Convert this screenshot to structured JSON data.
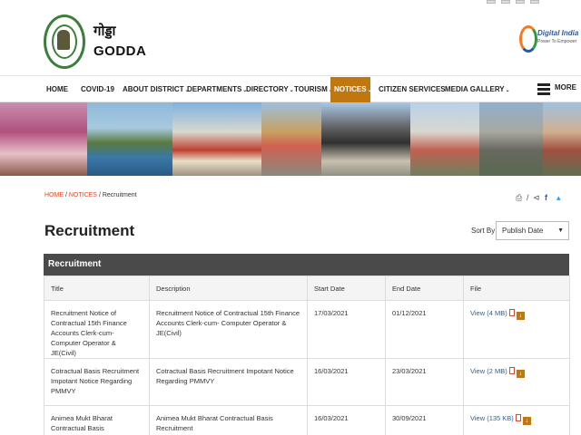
{
  "header": {
    "site_name_hindi": "गोड्डा",
    "site_name": "GODDA",
    "digital_india_title": "Digital India",
    "digital_india_tagline": "Power To Empower"
  },
  "nav": {
    "items": [
      {
        "label": "HOME",
        "has_dropdown": false
      },
      {
        "label": "COVID-19",
        "has_dropdown": false
      },
      {
        "label": "ABOUT DISTRICT",
        "has_dropdown": true
      },
      {
        "label": "DEPARTMENTS",
        "has_dropdown": true
      },
      {
        "label": "DIRECTORY",
        "has_dropdown": true
      },
      {
        "label": "TOURISM",
        "has_dropdown": true
      },
      {
        "label": "NOTICES",
        "has_dropdown": true,
        "active": true
      },
      {
        "label": "CITIZEN SERVICES",
        "has_dropdown": false
      },
      {
        "label": "MEDIA GALLERY",
        "has_dropdown": true
      }
    ],
    "more_label": "MORE",
    "active_color": "#c0770f"
  },
  "breadcrumb": {
    "home": "HOME",
    "notices": "NOTICES",
    "current": "Recruitment",
    "separator": "/"
  },
  "share": {
    "separator": "/"
  },
  "page": {
    "title": "Recruitment"
  },
  "sort": {
    "label": "Sort By:",
    "selected": "Publish Date"
  },
  "table": {
    "caption": "Recruitment",
    "columns": [
      "Title",
      "Description",
      "Start Date",
      "End Date",
      "File"
    ],
    "rows": [
      {
        "title": "Recruitment Notice of Contractual 15th Finance Accounts Clerk-cum- Computer Operator & JE(Civil)",
        "description": "Recruitment Notice of Contractual 15th Finance Accounts Clerk-cum- Computer Operator & JE(Civil)",
        "start_date": "17/03/2021",
        "end_date": "01/12/2021",
        "file": "View (4 MB)"
      },
      {
        "title": "Cotractual Basis Recruitment Impotant Notice Regarding PMMVY",
        "description": "Cotractual Basis Recruitment Impotant Notice Regarding PMMVY",
        "start_date": "16/03/2021",
        "end_date": "23/03/2021",
        "file": "View (2 MB)"
      },
      {
        "title": "Animea Mukt Bharat Contractual Basis Recruitment Important",
        "description": "Animea Mukt Bharat Contractual Basis Recruitment",
        "start_date": "16/03/2021",
        "end_date": "30/09/2021",
        "file": "View (135 KB)"
      }
    ]
  },
  "colors": {
    "table_header_bg": "#4a4a4a",
    "link": "#2a5db0",
    "breadcrumb_link": "#d94a2a",
    "accent": "#c0770f"
  }
}
